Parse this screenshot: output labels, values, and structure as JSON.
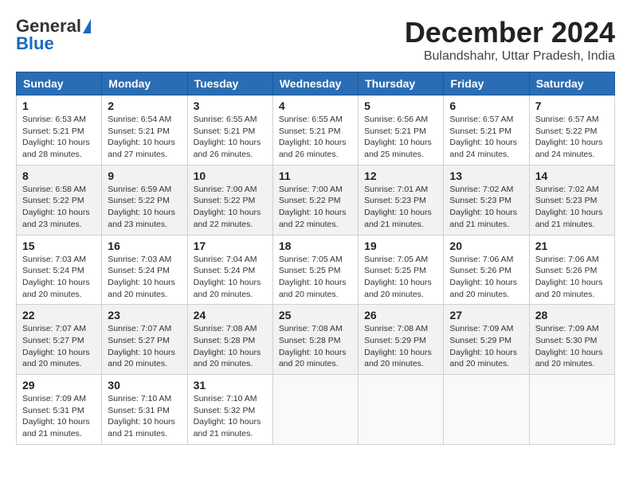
{
  "logo": {
    "general": "General",
    "blue": "Blue"
  },
  "title": "December 2024",
  "subtitle": "Bulandshahr, Uttar Pradesh, India",
  "weekdays": [
    "Sunday",
    "Monday",
    "Tuesday",
    "Wednesday",
    "Thursday",
    "Friday",
    "Saturday"
  ],
  "weeks": [
    [
      {
        "day": "1",
        "sunrise": "6:53 AM",
        "sunset": "5:21 PM",
        "daylight": "10 hours and 28 minutes."
      },
      {
        "day": "2",
        "sunrise": "6:54 AM",
        "sunset": "5:21 PM",
        "daylight": "10 hours and 27 minutes."
      },
      {
        "day": "3",
        "sunrise": "6:55 AM",
        "sunset": "5:21 PM",
        "daylight": "10 hours and 26 minutes."
      },
      {
        "day": "4",
        "sunrise": "6:55 AM",
        "sunset": "5:21 PM",
        "daylight": "10 hours and 26 minutes."
      },
      {
        "day": "5",
        "sunrise": "6:56 AM",
        "sunset": "5:21 PM",
        "daylight": "10 hours and 25 minutes."
      },
      {
        "day": "6",
        "sunrise": "6:57 AM",
        "sunset": "5:21 PM",
        "daylight": "10 hours and 24 minutes."
      },
      {
        "day": "7",
        "sunrise": "6:57 AM",
        "sunset": "5:22 PM",
        "daylight": "10 hours and 24 minutes."
      }
    ],
    [
      {
        "day": "8",
        "sunrise": "6:58 AM",
        "sunset": "5:22 PM",
        "daylight": "10 hours and 23 minutes."
      },
      {
        "day": "9",
        "sunrise": "6:59 AM",
        "sunset": "5:22 PM",
        "daylight": "10 hours and 23 minutes."
      },
      {
        "day": "10",
        "sunrise": "7:00 AM",
        "sunset": "5:22 PM",
        "daylight": "10 hours and 22 minutes."
      },
      {
        "day": "11",
        "sunrise": "7:00 AM",
        "sunset": "5:22 PM",
        "daylight": "10 hours and 22 minutes."
      },
      {
        "day": "12",
        "sunrise": "7:01 AM",
        "sunset": "5:23 PM",
        "daylight": "10 hours and 21 minutes."
      },
      {
        "day": "13",
        "sunrise": "7:02 AM",
        "sunset": "5:23 PM",
        "daylight": "10 hours and 21 minutes."
      },
      {
        "day": "14",
        "sunrise": "7:02 AM",
        "sunset": "5:23 PM",
        "daylight": "10 hours and 21 minutes."
      }
    ],
    [
      {
        "day": "15",
        "sunrise": "7:03 AM",
        "sunset": "5:24 PM",
        "daylight": "10 hours and 20 minutes."
      },
      {
        "day": "16",
        "sunrise": "7:03 AM",
        "sunset": "5:24 PM",
        "daylight": "10 hours and 20 minutes."
      },
      {
        "day": "17",
        "sunrise": "7:04 AM",
        "sunset": "5:24 PM",
        "daylight": "10 hours and 20 minutes."
      },
      {
        "day": "18",
        "sunrise": "7:05 AM",
        "sunset": "5:25 PM",
        "daylight": "10 hours and 20 minutes."
      },
      {
        "day": "19",
        "sunrise": "7:05 AM",
        "sunset": "5:25 PM",
        "daylight": "10 hours and 20 minutes."
      },
      {
        "day": "20",
        "sunrise": "7:06 AM",
        "sunset": "5:26 PM",
        "daylight": "10 hours and 20 minutes."
      },
      {
        "day": "21",
        "sunrise": "7:06 AM",
        "sunset": "5:26 PM",
        "daylight": "10 hours and 20 minutes."
      }
    ],
    [
      {
        "day": "22",
        "sunrise": "7:07 AM",
        "sunset": "5:27 PM",
        "daylight": "10 hours and 20 minutes."
      },
      {
        "day": "23",
        "sunrise": "7:07 AM",
        "sunset": "5:27 PM",
        "daylight": "10 hours and 20 minutes."
      },
      {
        "day": "24",
        "sunrise": "7:08 AM",
        "sunset": "5:28 PM",
        "daylight": "10 hours and 20 minutes."
      },
      {
        "day": "25",
        "sunrise": "7:08 AM",
        "sunset": "5:28 PM",
        "daylight": "10 hours and 20 minutes."
      },
      {
        "day": "26",
        "sunrise": "7:08 AM",
        "sunset": "5:29 PM",
        "daylight": "10 hours and 20 minutes."
      },
      {
        "day": "27",
        "sunrise": "7:09 AM",
        "sunset": "5:29 PM",
        "daylight": "10 hours and 20 minutes."
      },
      {
        "day": "28",
        "sunrise": "7:09 AM",
        "sunset": "5:30 PM",
        "daylight": "10 hours and 20 minutes."
      }
    ],
    [
      {
        "day": "29",
        "sunrise": "7:09 AM",
        "sunset": "5:31 PM",
        "daylight": "10 hours and 21 minutes."
      },
      {
        "day": "30",
        "sunrise": "7:10 AM",
        "sunset": "5:31 PM",
        "daylight": "10 hours and 21 minutes."
      },
      {
        "day": "31",
        "sunrise": "7:10 AM",
        "sunset": "5:32 PM",
        "daylight": "10 hours and 21 minutes."
      },
      null,
      null,
      null,
      null
    ]
  ]
}
